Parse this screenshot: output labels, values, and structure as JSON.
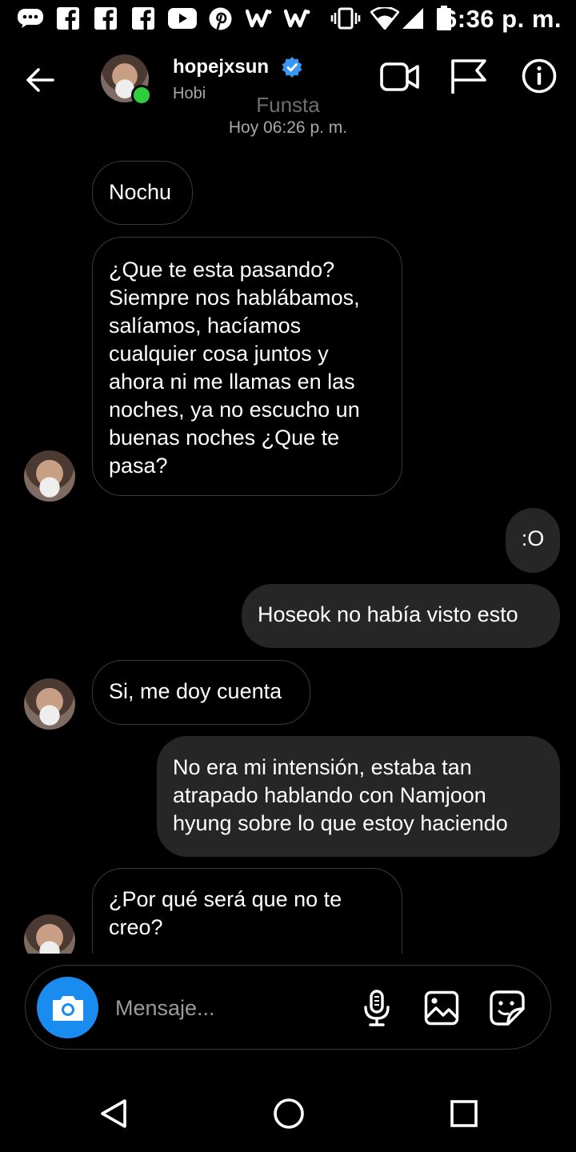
{
  "status_bar": {
    "time": "6:36 p. m.",
    "left_icons": [
      "chat-bubble-icon",
      "facebook-icon",
      "facebook-icon",
      "facebook-icon",
      "youtube-icon",
      "pinterest-icon",
      "w-app-icon",
      "w-app-icon"
    ],
    "right_icons": [
      "vibrate-icon",
      "wifi-icon",
      "signal-icon",
      "battery-icon"
    ]
  },
  "header": {
    "username": "hopejxsun",
    "subtitle": "Hobi",
    "icons": [
      "back-arrow-icon",
      "video-call-icon",
      "flag-icon",
      "info-icon"
    ]
  },
  "conversation": {
    "label": "Funsta",
    "timestamp": "Hoy 06:26 p. m."
  },
  "messages": [
    {
      "from": "them",
      "text": "Nochu"
    },
    {
      "from": "them",
      "text": "¿Que te esta pasando? Siempre nos hablábamos, salíamos, hacíamos cualquier cosa juntos y ahora ni me llamas en las noches, ya no escucho un buenas noches ¿Que te pasa?"
    },
    {
      "from": "me",
      "text": ":O"
    },
    {
      "from": "me",
      "text": "Hoseok no había visto esto"
    },
    {
      "from": "them",
      "text": "Si, me doy cuenta"
    },
    {
      "from": "me",
      "text": "No era mi intensión, estaba tan atrapado hablando con Namjoon hyung sobre lo que estoy haciendo"
    },
    {
      "from": "them",
      "text": "¿Por qué será que no te creo?"
    }
  ],
  "composer": {
    "placeholder": "Mensaje...",
    "icons": [
      "camera-icon",
      "microphone-icon",
      "gallery-icon",
      "sticker-icon"
    ]
  },
  "nav": {
    "icons": [
      "back-triangle-icon",
      "home-circle-icon",
      "recents-square-icon"
    ]
  },
  "colors": {
    "background": "#000000",
    "outgoing_bubble": "#262626",
    "incoming_border": "#3a3a3a",
    "accent_blue": "#1a8cf0",
    "online_green": "#2fce3c",
    "verified_blue": "#3897f0"
  }
}
